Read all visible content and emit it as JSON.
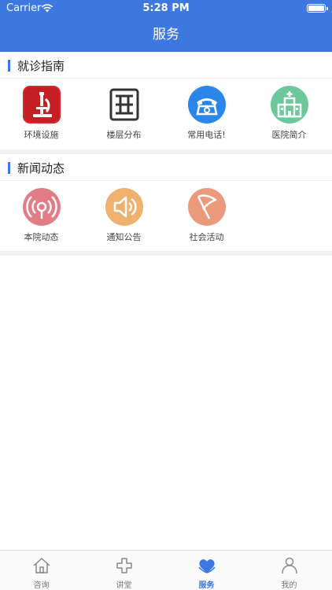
{
  "status_bar": {
    "carrier": "Carrier",
    "time": "5:28 PM"
  },
  "nav": {
    "title": "服务"
  },
  "sections": [
    {
      "title": "就诊指南",
      "items": [
        {
          "label": "环境设施",
          "icon": "microscope-icon",
          "color": "#d22a2a"
        },
        {
          "label": "楼层分布",
          "icon": "floor-plan-icon",
          "color": "#333333"
        },
        {
          "label": "常用电话!",
          "icon": "telephone-icon",
          "color": "#2a86e8"
        },
        {
          "label": "医院简介",
          "icon": "hospital-building-icon",
          "color": "#6cc79a"
        }
      ]
    },
    {
      "title": "新闻动态",
      "items": [
        {
          "label": "本院动态",
          "icon": "broadcast-icon",
          "color": "#e27d86"
        },
        {
          "label": "通知公告",
          "icon": "speaker-icon",
          "color": "#f0b06e"
        },
        {
          "label": "社会活动",
          "icon": "flag-icon",
          "color": "#ec9a7c"
        }
      ]
    }
  ],
  "tabs": [
    {
      "label": "咨询",
      "icon": "home-icon",
      "active": false
    },
    {
      "label": "讲堂",
      "icon": "cross-outline-icon",
      "active": false
    },
    {
      "label": "服务",
      "icon": "heart-hands-icon",
      "active": true
    },
    {
      "label": "我的",
      "icon": "person-icon",
      "active": false
    }
  ],
  "colors": {
    "primary": "#3d78e0",
    "text": "#222222",
    "tab_inactive": "#777777"
  }
}
